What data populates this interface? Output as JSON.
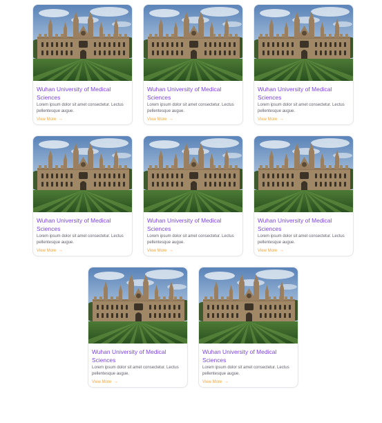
{
  "cards": [
    {
      "image_alt": "university building with lawn",
      "title": "Wuhan University of Medical Sciences",
      "description": "Lorem ipsum dolor sit amet consectetur. Lectus pellentesque augue.",
      "link_label": "View More",
      "link_icon": "arrow-right-icon"
    },
    {
      "image_alt": "university building with lawn",
      "title": "Wuhan University of Medical Sciences",
      "description": "Lorem ipsum dolor sit amet consectetur. Lectus pellentesque augue.",
      "link_label": "View More",
      "link_icon": "arrow-right-icon"
    },
    {
      "image_alt": "university building with lawn",
      "title": "Wuhan University of Medical Sciences",
      "description": "Lorem ipsum dolor sit amet consectetur. Lectus pellentesque augue.",
      "link_label": "View More",
      "link_icon": "arrow-right-icon"
    },
    {
      "image_alt": "university building with lawn",
      "title": "Wuhan University of Medical Sciences",
      "description": "Lorem ipsum dolor sit amet consectetur. Lectus pellentesque augue.",
      "link_label": "View More",
      "link_icon": "arrow-right-icon"
    },
    {
      "image_alt": "university building with lawn",
      "title": "Wuhan University of Medical Sciences",
      "description": "Lorem ipsum dolor sit amet consectetur. Lectus pellentesque augue.",
      "link_label": "View More",
      "link_icon": "arrow-right-icon"
    },
    {
      "image_alt": "university building with lawn",
      "title": "Wuhan University of Medical Sciences",
      "description": "Lorem ipsum dolor sit amet consectetur. Lectus pellentesque augue.",
      "link_label": "View More",
      "link_icon": "arrow-right-icon"
    },
    {
      "image_alt": "university building with lawn",
      "title": "Wuhan University of Medical Sciences",
      "description": "Lorem ipsum dolor sit amet consectetur. Lectus pellentesque augue.",
      "link_label": "View More",
      "link_icon": "arrow-right-icon"
    },
    {
      "image_alt": "university building with lawn",
      "title": "Wuhan University of Medical Sciences",
      "description": "Lorem ipsum dolor sit amet consectetur. Lectus pellentesque augue.",
      "link_label": "View More",
      "link_icon": "arrow-right-icon"
    }
  ],
  "colors": {
    "title": "#7b3fe4",
    "link": "#f1a43a",
    "description": "#5d5d6a",
    "card_border": "#e6e6ea"
  }
}
